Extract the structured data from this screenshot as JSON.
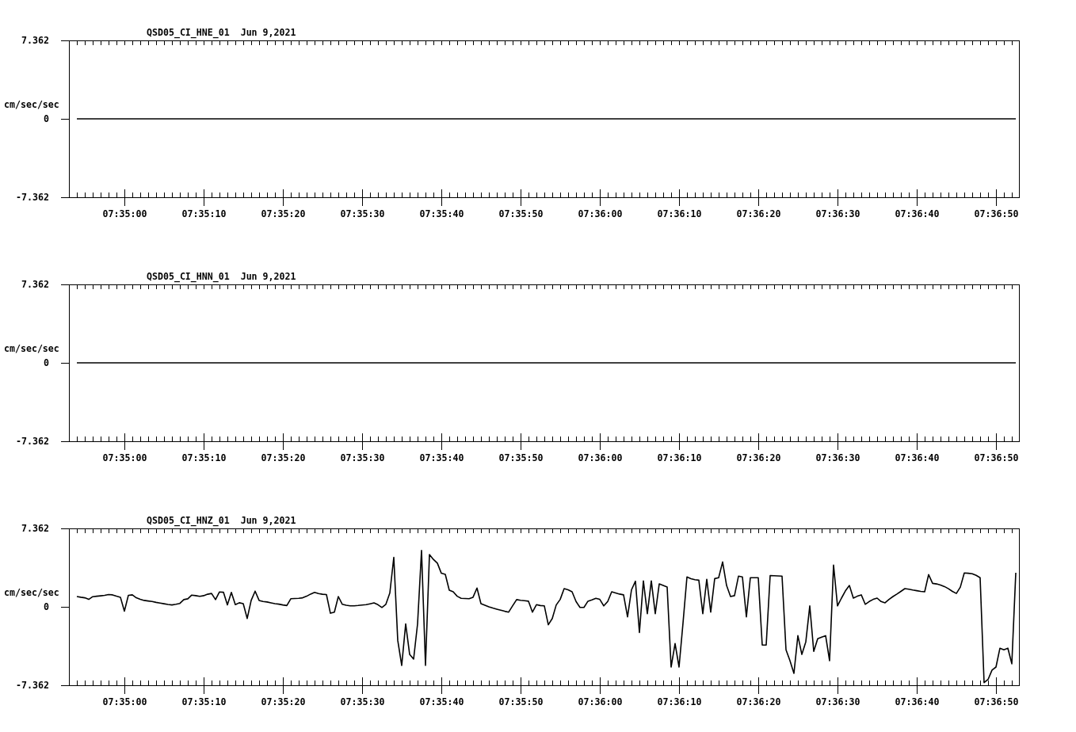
{
  "panels": [
    {
      "chart_data": {
        "type": "line",
        "title": "QSD05_CI_HNE_01  Jun 9,2021",
        "ylabel": "cm/sec/sec",
        "categories": [
          null,
          null,
          null,
          null,
          null,
          null,
          null,
          null,
          null,
          null,
          null,
          null,
          "07:35:00",
          null,
          null,
          null,
          null,
          null,
          null,
          null,
          null,
          null,
          null,
          null,
          null,
          null,
          null,
          null,
          null,
          null,
          null,
          null,
          "07:35:10",
          null,
          null,
          null,
          null,
          null,
          null,
          null,
          null,
          null,
          null,
          null,
          null,
          null,
          null,
          null,
          null,
          null,
          null,
          null,
          "07:35:20",
          null,
          null,
          null,
          null,
          null,
          null,
          null,
          null,
          null,
          null,
          null,
          null,
          null,
          null,
          null,
          null,
          null,
          null,
          null,
          "07:35:30",
          null,
          null,
          null,
          null,
          null,
          null,
          null,
          null,
          null,
          null,
          null,
          null,
          null,
          null,
          null,
          null,
          null,
          null,
          null,
          "07:35:40",
          null,
          null,
          null,
          null,
          null,
          null,
          null,
          null,
          null,
          null,
          null,
          null,
          null,
          null,
          null,
          null,
          null,
          null,
          null,
          "07:35:50",
          null,
          null,
          null,
          null,
          null,
          null,
          null,
          null,
          null,
          null,
          null,
          null,
          null,
          null,
          null,
          null,
          null,
          null,
          null,
          "07:36:00",
          null,
          null,
          null,
          null,
          null,
          null,
          null,
          null,
          null,
          null,
          null,
          null,
          null,
          null,
          null,
          null,
          null,
          null,
          null,
          "07:36:10",
          null,
          null,
          null,
          null,
          null,
          null,
          null,
          null,
          null,
          null,
          null,
          null,
          null,
          null,
          null,
          null,
          null,
          null,
          null,
          "07:36:20",
          null,
          null,
          null,
          null,
          null,
          null,
          null,
          null,
          null,
          null,
          null,
          null,
          null,
          null,
          null,
          null,
          null,
          null,
          null,
          "07:36:30",
          null,
          null,
          null,
          null,
          null,
          null,
          null,
          null,
          null,
          null,
          null,
          null,
          null,
          null,
          null,
          null,
          null,
          null,
          null,
          "07:36:40",
          null,
          null,
          null,
          null,
          null,
          null,
          null,
          null,
          null,
          null,
          null,
          null,
          null,
          null,
          null,
          null,
          null,
          null,
          null,
          "07:36:50",
          null,
          null,
          null,
          null,
          null
        ],
        "values": [
          0,
          0,
          0,
          0,
          0,
          0,
          0,
          0,
          0,
          0,
          0,
          0,
          0,
          0,
          0,
          0,
          0,
          0,
          0,
          0,
          0,
          0,
          0,
          0,
          0,
          0,
          0,
          0,
          0,
          0,
          0,
          0,
          0,
          0,
          0,
          0,
          0,
          0,
          0,
          0,
          0,
          0,
          0,
          0,
          0,
          0,
          0,
          0,
          0,
          0,
          0,
          0,
          0,
          0,
          0,
          0,
          0,
          0,
          0,
          0,
          0,
          0,
          0,
          0,
          0,
          0,
          0,
          0,
          0,
          0,
          0,
          0,
          0,
          0,
          0,
          0,
          0,
          0,
          0,
          0,
          0,
          0,
          0,
          0,
          0,
          0,
          0,
          0,
          0,
          0,
          0,
          0,
          0,
          0,
          0,
          0,
          0,
          0,
          0,
          0,
          0,
          0,
          0,
          0,
          0,
          0,
          0,
          0,
          0,
          0,
          0,
          0,
          0,
          0,
          0,
          0,
          0,
          0,
          0,
          0,
          0,
          0,
          0,
          0,
          0,
          0,
          0,
          0,
          0,
          0,
          0,
          0,
          0,
          0,
          0,
          0,
          0,
          0,
          0,
          0,
          0,
          0,
          0,
          0,
          0,
          0,
          0,
          0,
          0,
          0,
          0,
          0,
          0,
          0,
          0,
          0,
          0,
          0,
          0,
          0,
          0,
          0,
          0,
          0,
          0,
          0,
          0,
          0,
          0,
          0,
          0,
          0,
          0,
          0,
          0,
          0,
          0,
          0,
          0,
          0,
          0,
          0,
          0,
          0,
          0,
          0,
          0,
          0,
          0,
          0,
          0,
          0,
          0,
          0,
          0,
          0,
          0,
          0,
          0,
          0,
          0,
          0,
          0,
          0,
          0,
          0,
          0,
          0,
          0,
          0,
          0,
          0,
          0,
          0,
          0,
          0,
          0,
          0,
          0,
          0,
          0,
          0,
          0,
          0,
          0,
          0,
          0,
          0,
          0,
          0,
          0,
          0,
          0,
          0,
          0,
          0,
          0,
          0
        ],
        "ylim": [
          -7.362,
          7.362
        ],
        "yticks": [
          {
            "value": 7.362,
            "label": "7.362"
          },
          {
            "value": 0,
            "label": "0"
          },
          {
            "value": -7.362,
            "label": "-7.362"
          }
        ]
      }
    },
    {
      "chart_data": {
        "type": "line",
        "title": "QSD05_CI_HNN_01  Jun 9,2021",
        "ylabel": "cm/sec/sec",
        "categories": [
          null,
          null,
          null,
          null,
          null,
          null,
          null,
          null,
          null,
          null,
          null,
          null,
          "07:35:00",
          null,
          null,
          null,
          null,
          null,
          null,
          null,
          null,
          null,
          null,
          null,
          null,
          null,
          null,
          null,
          null,
          null,
          null,
          null,
          "07:35:10",
          null,
          null,
          null,
          null,
          null,
          null,
          null,
          null,
          null,
          null,
          null,
          null,
          null,
          null,
          null,
          null,
          null,
          null,
          null,
          "07:35:20",
          null,
          null,
          null,
          null,
          null,
          null,
          null,
          null,
          null,
          null,
          null,
          null,
          null,
          null,
          null,
          null,
          null,
          null,
          null,
          "07:35:30",
          null,
          null,
          null,
          null,
          null,
          null,
          null,
          null,
          null,
          null,
          null,
          null,
          null,
          null,
          null,
          null,
          null,
          null,
          null,
          "07:35:40",
          null,
          null,
          null,
          null,
          null,
          null,
          null,
          null,
          null,
          null,
          null,
          null,
          null,
          null,
          null,
          null,
          null,
          null,
          null,
          "07:35:50",
          null,
          null,
          null,
          null,
          null,
          null,
          null,
          null,
          null,
          null,
          null,
          null,
          null,
          null,
          null,
          null,
          null,
          null,
          null,
          "07:36:00",
          null,
          null,
          null,
          null,
          null,
          null,
          null,
          null,
          null,
          null,
          null,
          null,
          null,
          null,
          null,
          null,
          null,
          null,
          null,
          "07:36:10",
          null,
          null,
          null,
          null,
          null,
          null,
          null,
          null,
          null,
          null,
          null,
          null,
          null,
          null,
          null,
          null,
          null,
          null,
          null,
          "07:36:20",
          null,
          null,
          null,
          null,
          null,
          null,
          null,
          null,
          null,
          null,
          null,
          null,
          null,
          null,
          null,
          null,
          null,
          null,
          null,
          "07:36:30",
          null,
          null,
          null,
          null,
          null,
          null,
          null,
          null,
          null,
          null,
          null,
          null,
          null,
          null,
          null,
          null,
          null,
          null,
          null,
          "07:36:40",
          null,
          null,
          null,
          null,
          null,
          null,
          null,
          null,
          null,
          null,
          null,
          null,
          null,
          null,
          null,
          null,
          null,
          null,
          null,
          "07:36:50",
          null,
          null,
          null,
          null,
          null
        ],
        "values": [
          0,
          0,
          0,
          0,
          0,
          0,
          0,
          0,
          0,
          0,
          0,
          0,
          0,
          0,
          0,
          0,
          0,
          0,
          0,
          0,
          0,
          0,
          0,
          0,
          0,
          0,
          0,
          0,
          0,
          0,
          0,
          0,
          0,
          0,
          0,
          0,
          0,
          0,
          0,
          0,
          0,
          0,
          0,
          0,
          0,
          0,
          0,
          0,
          0,
          0,
          0,
          0,
          0,
          0,
          0,
          0,
          0,
          0,
          0,
          0,
          0,
          0,
          0,
          0,
          0,
          0,
          0,
          0,
          0,
          0,
          0,
          0,
          0,
          0,
          0,
          0,
          0,
          0,
          0,
          0,
          0,
          0,
          0,
          0,
          0,
          0,
          0,
          0,
          0,
          0,
          0,
          0,
          0,
          0,
          0,
          0,
          0,
          0,
          0,
          0,
          0,
          0,
          0,
          0,
          0,
          0,
          0,
          0,
          0,
          0,
          0,
          0,
          0,
          0,
          0,
          0,
          0,
          0,
          0,
          0,
          0,
          0,
          0,
          0,
          0,
          0,
          0,
          0,
          0,
          0,
          0,
          0,
          0,
          0,
          0,
          0,
          0,
          0,
          0,
          0,
          0,
          0,
          0,
          0,
          0,
          0,
          0,
          0,
          0,
          0,
          0,
          0,
          0,
          0,
          0,
          0,
          0,
          0,
          0,
          0,
          0,
          0,
          0,
          0,
          0,
          0,
          0,
          0,
          0,
          0,
          0,
          0,
          0,
          0,
          0,
          0,
          0,
          0,
          0,
          0,
          0,
          0,
          0,
          0,
          0,
          0,
          0,
          0,
          0,
          0,
          0,
          0,
          0,
          0,
          0,
          0,
          0,
          0,
          0,
          0,
          0,
          0,
          0,
          0,
          0,
          0,
          0,
          0,
          0,
          0,
          0,
          0,
          0,
          0,
          0,
          0,
          0,
          0,
          0,
          0,
          0,
          0,
          0,
          0,
          0,
          0,
          0,
          0,
          0,
          0,
          0,
          0,
          0,
          0,
          0,
          0,
          0,
          0
        ],
        "ylim": [
          -7.362,
          7.362
        ],
        "yticks": [
          {
            "value": 7.362,
            "label": "7.362"
          },
          {
            "value": 0,
            "label": "0"
          },
          {
            "value": -7.362,
            "label": "-7.362"
          }
        ]
      }
    },
    {
      "chart_data": {
        "type": "line",
        "title": "QSD05_CI_HNZ_01  Jun 9,2021",
        "ylabel": "cm/sec/sec",
        "categories": [
          null,
          null,
          null,
          null,
          null,
          null,
          null,
          null,
          null,
          null,
          null,
          null,
          "07:35:00",
          null,
          null,
          null,
          null,
          null,
          null,
          null,
          null,
          null,
          null,
          null,
          null,
          null,
          null,
          null,
          null,
          null,
          null,
          null,
          "07:35:10",
          null,
          null,
          null,
          null,
          null,
          null,
          null,
          null,
          null,
          null,
          null,
          null,
          null,
          null,
          null,
          null,
          null,
          null,
          null,
          "07:35:20",
          null,
          null,
          null,
          null,
          null,
          null,
          null,
          null,
          null,
          null,
          null,
          null,
          null,
          null,
          null,
          null,
          null,
          null,
          null,
          "07:35:30",
          null,
          null,
          null,
          null,
          null,
          null,
          null,
          null,
          null,
          null,
          null,
          null,
          null,
          null,
          null,
          null,
          null,
          null,
          null,
          "07:35:40",
          null,
          null,
          null,
          null,
          null,
          null,
          null,
          null,
          null,
          null,
          null,
          null,
          null,
          null,
          null,
          null,
          null,
          null,
          null,
          "07:35:50",
          null,
          null,
          null,
          null,
          null,
          null,
          null,
          null,
          null,
          null,
          null,
          null,
          null,
          null,
          null,
          null,
          null,
          null,
          null,
          "07:36:00",
          null,
          null,
          null,
          null,
          null,
          null,
          null,
          null,
          null,
          null,
          null,
          null,
          null,
          null,
          null,
          null,
          null,
          null,
          null,
          "07:36:10",
          null,
          null,
          null,
          null,
          null,
          null,
          null,
          null,
          null,
          null,
          null,
          null,
          null,
          null,
          null,
          null,
          null,
          null,
          null,
          "07:36:20",
          null,
          null,
          null,
          null,
          null,
          null,
          null,
          null,
          null,
          null,
          null,
          null,
          null,
          null,
          null,
          null,
          null,
          null,
          null,
          "07:36:30",
          null,
          null,
          null,
          null,
          null,
          null,
          null,
          null,
          null,
          null,
          null,
          null,
          null,
          null,
          null,
          null,
          null,
          null,
          null,
          "07:36:40",
          null,
          null,
          null,
          null,
          null,
          null,
          null,
          null,
          null,
          null,
          null,
          null,
          null,
          null,
          null,
          null,
          null,
          null,
          null,
          "07:36:50",
          null,
          null,
          null,
          null,
          null
        ],
        "values": [
          0.97,
          0.9,
          0.85,
          0.7,
          0.95,
          1.0,
          1.03,
          1.08,
          1.15,
          1.12,
          1.0,
          0.9,
          -0.41,
          1.08,
          1.12,
          0.85,
          0.7,
          0.6,
          0.55,
          0.5,
          0.42,
          0.35,
          0.29,
          0.22,
          0.18,
          0.24,
          0.32,
          0.68,
          0.75,
          1.1,
          1.05,
          0.98,
          1.05,
          1.18,
          1.26,
          0.68,
          1.4,
          1.37,
          0.18,
          1.35,
          0.2,
          0.38,
          0.3,
          -1.09,
          0.6,
          1.47,
          0.6,
          0.5,
          0.45,
          0.37,
          0.3,
          0.25,
          0.18,
          0.12,
          0.76,
          0.78,
          0.8,
          0.85,
          1.0,
          1.2,
          1.35,
          1.25,
          1.18,
          1.15,
          -0.6,
          -0.5,
          0.97,
          0.24,
          0.15,
          0.1,
          0.1,
          0.13,
          0.17,
          0.2,
          0.28,
          0.37,
          0.2,
          -0.06,
          0.24,
          1.3,
          4.65,
          -3.15,
          -5.5,
          -1.6,
          -4.47,
          -4.91,
          -1.6,
          5.3,
          -5.5,
          4.9,
          4.45,
          4.1,
          3.15,
          3.05,
          1.56,
          1.41,
          1.0,
          0.8,
          0.78,
          0.76,
          0.9,
          1.76,
          0.3,
          0.15,
          0.0,
          -0.12,
          -0.22,
          -0.32,
          -0.42,
          -0.5,
          0.1,
          0.68,
          0.62,
          0.57,
          0.53,
          -0.5,
          0.2,
          0.12,
          0.09,
          -1.68,
          -1.09,
          0.18,
          0.7,
          1.71,
          1.6,
          1.41,
          0.5,
          -0.06,
          -0.06,
          0.53,
          0.65,
          0.8,
          0.7,
          0.09,
          0.5,
          1.41,
          1.3,
          1.2,
          1.12,
          -0.94,
          1.6,
          2.4,
          -2.41,
          2.44,
          -0.65,
          2.44,
          -0.65,
          2.15,
          2.0,
          1.85,
          -5.65,
          -3.44,
          -5.65,
          -1.53,
          2.8,
          2.65,
          2.55,
          2.5,
          -0.65,
          2.59,
          -0.5,
          2.65,
          2.74,
          4.21,
          2.0,
          0.97,
          1.05,
          2.88,
          2.8,
          -0.94,
          2.74,
          2.74,
          2.74,
          -3.59,
          -3.59,
          2.94,
          2.92,
          2.9,
          2.88,
          -4.03,
          -5.06,
          -6.24,
          -2.71,
          -4.47,
          -3.29,
          0.09,
          -4.18,
          -3.0,
          -2.85,
          -2.71,
          -5.06,
          3.91,
          0.09,
          0.82,
          1.5,
          2.0,
          0.82,
          1.0,
          1.12,
          0.24,
          0.5,
          0.7,
          0.82,
          0.5,
          0.38,
          0.7,
          0.97,
          1.2,
          1.45,
          1.71,
          1.65,
          1.58,
          1.52,
          1.45,
          1.41,
          3.03,
          2.2,
          2.15,
          2.05,
          1.9,
          1.7,
          1.45,
          1.26,
          1.85,
          3.18,
          3.15,
          3.1,
          2.95,
          2.74,
          -7.12,
          -6.82,
          -5.94,
          -5.65,
          -3.88,
          -4.03,
          -3.88,
          -5.35,
          3.2
        ],
        "ylim": [
          -7.362,
          7.362
        ],
        "yticks": [
          {
            "value": 7.362,
            "label": "7.362"
          },
          {
            "value": 0,
            "label": "0"
          },
          {
            "value": -7.362,
            "label": "-7.362"
          }
        ]
      }
    }
  ]
}
